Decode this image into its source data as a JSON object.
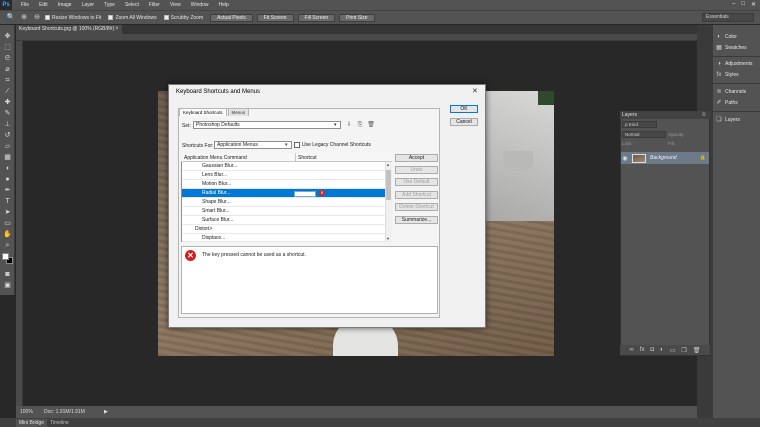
{
  "menubar": {
    "logo": "Ps",
    "items": [
      "File",
      "Edit",
      "Image",
      "Layer",
      "Type",
      "Select",
      "Filter",
      "View",
      "Window",
      "Help"
    ],
    "controls": [
      "–",
      "□",
      "✕"
    ]
  },
  "options": {
    "resize_windows": "Resize Windows to Fit",
    "zoom_all": "Zoom All Windows",
    "scrubby_zoom": "Scrubby Zoom",
    "actual_pixels": "Actual Pixels",
    "fit_screen": "Fit Screen",
    "fill_screen": "Fill Screen",
    "print_size": "Print Size",
    "workspace": "Essentials"
  },
  "document": {
    "tab_title": "Keyboard Shortcuts.jpg @ 100% (RGB/8#)",
    "tab_close": "×"
  },
  "status": {
    "zoom": "100%",
    "doc": "Doc: 1.91M/1.91M",
    "arrow": "▶"
  },
  "bottom_tabs": [
    "Mini Bridge",
    "Timeline"
  ],
  "right_dock": {
    "items": [
      {
        "icon": "color-icon",
        "label": "Color"
      },
      {
        "icon": "swatches-icon",
        "label": "Swatches"
      },
      {
        "icon": "adjustments-icon",
        "label": "Adjustments"
      },
      {
        "icon": "styles-icon",
        "label": "Styles"
      },
      {
        "icon": "channels-icon",
        "label": "Channels"
      },
      {
        "icon": "paths-icon",
        "label": "Paths"
      },
      {
        "icon": "layers-icon",
        "label": "Layers"
      }
    ]
  },
  "layers": {
    "tab": "Layers",
    "kind": "ρ Kind",
    "blend": "Normal",
    "opacity_label": "Opacity:",
    "lock_label": "Lock:",
    "fill_label": "Fill:",
    "layer_name": "Background",
    "footer_icons": [
      "∞",
      "fx",
      "◘",
      "◐",
      "▭",
      "❐",
      "🗑"
    ]
  },
  "dialog": {
    "title": "Keyboard Shortcuts and Menus",
    "close": "✕",
    "tabs": [
      "Keyboard Shortcuts",
      "Menus"
    ],
    "set_label": "Set:",
    "set_value": "Photoshop Defaults",
    "shortcuts_for_label": "Shortcuts For:",
    "shortcuts_for_value": "Application Menus",
    "legacy_label": "Use Legacy Channel Shortcuts",
    "col_command": "Application Menu Command",
    "col_shortcut": "Shortcut",
    "rows": [
      {
        "label": "Gaussian Blur...",
        "category": false
      },
      {
        "label": "Lens Blur...",
        "category": false
      },
      {
        "label": "Motion Blur...",
        "category": false
      },
      {
        "label": "Radial Blur...",
        "category": false,
        "selected": true
      },
      {
        "label": "Shape Blur...",
        "category": false
      },
      {
        "label": "Smart Blur...",
        "category": false
      },
      {
        "label": "Surface Blur...",
        "category": false
      },
      {
        "label": "Distort>",
        "category": true
      },
      {
        "label": "Displace...",
        "category": false
      }
    ],
    "side_buttons": [
      {
        "label": "Accept",
        "disabled": false
      },
      {
        "label": "Undo",
        "disabled": true
      },
      {
        "label": "Use Default",
        "disabled": true
      },
      {
        "label": "Add Shortcut",
        "disabled": true
      },
      {
        "label": "Delete Shortcut",
        "disabled": true
      },
      {
        "label": "Summarize...",
        "disabled": false
      }
    ],
    "message": "The key pressed cannot be used as a shortcut.",
    "ok": "OK",
    "cancel": "Cancel"
  }
}
